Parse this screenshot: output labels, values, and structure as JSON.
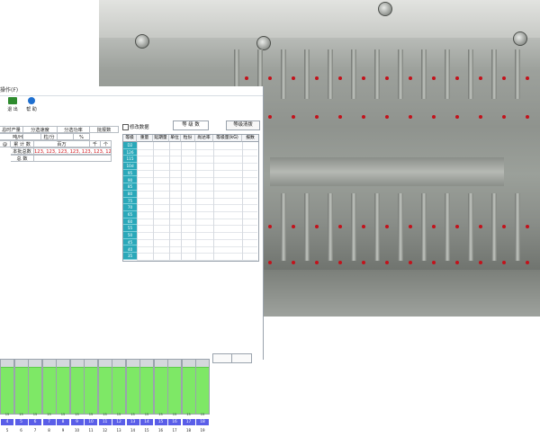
{
  "window": {
    "title": "操作(F)"
  },
  "toolbar": {
    "items": [
      {
        "name": "exit",
        "label": "退 出",
        "icon": "exit-icon",
        "color": "#2e8b2e"
      },
      {
        "name": "help",
        "label": "帮 助",
        "icon": "help-icon",
        "color": "#1e6fd0"
      }
    ]
  },
  "params": {
    "row1": [
      "总时产量",
      "分选速度",
      "分选功率",
      "批报数"
    ],
    "row2": [
      "吨/H",
      "",
      "粒/分",
      "",
      "%"
    ],
    "row3": [
      "@",
      "累 计 数",
      "百万",
      "千",
      "个"
    ],
    "row4_label": "本批总数",
    "row4_values": "123, 123, 123, 123, 123, 123, 12",
    "row5_label": "总 数"
  },
  "grade": {
    "checkbox_label": "修改数据",
    "count_label": "等 级 数",
    "clear_button": "等级清拨",
    "headers": [
      "等级名",
      "重量",
      "延期量",
      "单位",
      "粒份",
      "尚达率",
      "等级量(kG)",
      "报数"
    ],
    "rows": [
      "D2",
      "126",
      "115",
      "10d",
      "95",
      "90",
      "85",
      "80",
      "75",
      "70",
      "65",
      "60",
      "55",
      "50",
      "45",
      "40",
      "35"
    ]
  },
  "bins": {
    "top_labels": [
      "15",
      "15",
      "15",
      "15",
      "15",
      "15",
      "15",
      "15",
      "15",
      "15",
      "15",
      "15",
      "15",
      "15",
      "15"
    ],
    "numbers": [
      "4",
      "5",
      "6",
      "7",
      "8",
      "9",
      "10",
      "11",
      "12",
      "13",
      "14",
      "15",
      "16",
      "17",
      "18"
    ],
    "sub_labels": [
      "5",
      "6",
      "7",
      "8",
      "9",
      "10",
      "11",
      "12",
      "13",
      "14",
      "15",
      "16",
      "17",
      "18",
      "19"
    ],
    "fill_fractions": [
      0.85,
      0.85,
      0.85,
      0.85,
      0.85,
      0.85,
      0.85,
      0.85,
      0.85,
      0.85,
      0.85,
      0.85,
      0.85,
      0.85,
      0.85
    ],
    "fill_color": "#7ee866"
  }
}
